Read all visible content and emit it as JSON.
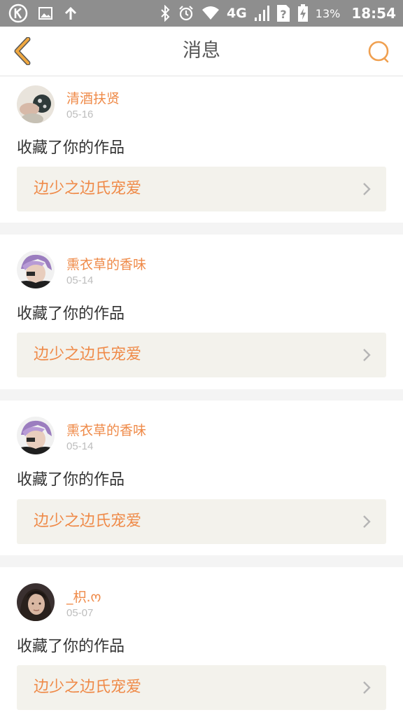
{
  "status_bar": {
    "battery": "13%",
    "time": "18:54",
    "network": "4G",
    "icons": [
      "k-app-icon",
      "image-icon",
      "upload-arrow-icon",
      "bluetooth-icon",
      "alarm-icon",
      "wifi-icon",
      "signal-icon",
      "sim-unknown-icon",
      "battery-charging-icon"
    ]
  },
  "header": {
    "title": "消息",
    "back_icon": "back-chevron-icon",
    "search_icon": "search-icon",
    "accent": "#f0a840"
  },
  "messages": [
    {
      "username": "清酒扶贤",
      "date": "05-16",
      "action": "收藏了你的作品",
      "work_title": "边少之边氏宠爱"
    },
    {
      "username": "熏衣草的香味",
      "date": "05-14",
      "action": "收藏了你的作品",
      "work_title": "边少之边氏宠爱"
    },
    {
      "username": "熏衣草的香味",
      "date": "05-14",
      "action": "收藏了你的作品",
      "work_title": "边少之边氏宠爱"
    },
    {
      "username": "_枳.ო",
      "date": "05-07",
      "action": "收藏了你的作品",
      "work_title": "边少之边氏宠爱"
    }
  ],
  "colors": {
    "username": "#ef8a48",
    "link_bg": "#f3f2ec",
    "status_bar": "#8e8e8e"
  }
}
